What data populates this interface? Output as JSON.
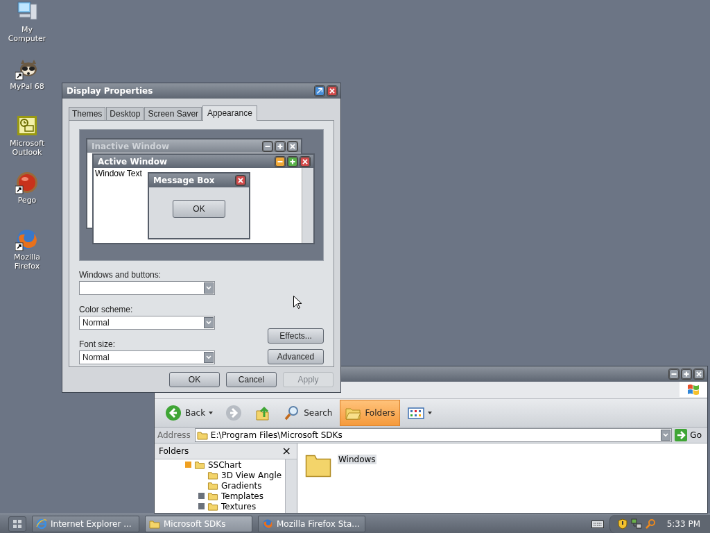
{
  "desktop_icons": [
    {
      "label": "My Computer",
      "kind": "computer",
      "shortcut": false
    },
    {
      "label": "MyPal 68",
      "kind": "raccoon",
      "shortcut": true
    },
    {
      "label": "Microsoft Outlook",
      "kind": "outlook",
      "shortcut": false
    },
    {
      "label": "Pego",
      "kind": "orb",
      "shortcut": true
    },
    {
      "label": "Mozilla Firefox",
      "kind": "firefox",
      "shortcut": true
    }
  ],
  "display_properties": {
    "title": "Display Properties",
    "tabs": [
      {
        "label": "Themes",
        "selected": false
      },
      {
        "label": "Desktop",
        "selected": false
      },
      {
        "label": "Screen Saver",
        "selected": false
      },
      {
        "label": "Appearance",
        "selected": true
      }
    ],
    "preview": {
      "inactive_title": "Inactive Window",
      "active_title": "Active Window",
      "window_text": "Window Text",
      "message_title": "Message Box",
      "message_button": "OK"
    },
    "fields": [
      {
        "label": "Windows and buttons:"
      },
      {
        "label": "Color scheme:",
        "value": "Normal"
      },
      {
        "label": "Font size:",
        "value": "Normal"
      }
    ],
    "side_buttons": [
      "Effects...",
      "Advanced"
    ],
    "buttons": [
      {
        "label": "OK",
        "disabled": false
      },
      {
        "label": "Cancel",
        "disabled": false
      },
      {
        "label": "Apply",
        "disabled": true
      }
    ]
  },
  "explorer": {
    "toolbar": [
      {
        "kind": "back",
        "label": "Back",
        "selected": false
      },
      {
        "kind": "forward",
        "selected": false
      },
      {
        "kind": "up",
        "selected": false
      },
      {
        "kind": "search",
        "label": "Search",
        "selected": false
      },
      {
        "kind": "folders",
        "label": "Folders",
        "selected": true
      },
      {
        "kind": "views",
        "selected": false
      }
    ],
    "address_label": "Address",
    "address": "E:\\Program Files\\Microsoft SDKs",
    "go": "Go",
    "folders_title": "Folders",
    "folders_close": "×",
    "tree": [
      {
        "label": "SSChart",
        "expanded": true,
        "children": [
          {
            "label": "3D View Angle"
          },
          {
            "label": "Gradients"
          },
          {
            "label": "Templates",
            "expanded": false
          },
          {
            "label": "Textures",
            "expanded": false
          }
        ]
      }
    ],
    "files": [
      {
        "name": "Windows",
        "selected": true
      }
    ]
  },
  "taskbar": {
    "tasks": [
      {
        "label": "Internet Explorer ...",
        "kind": "ie",
        "selected": false
      },
      {
        "label": "Microsoft SDKs",
        "kind": "folder",
        "selected": true
      },
      {
        "label": "Mozilla Firefox Sta...",
        "kind": "firefox",
        "selected": false
      }
    ],
    "clock": "5:33 PM"
  }
}
